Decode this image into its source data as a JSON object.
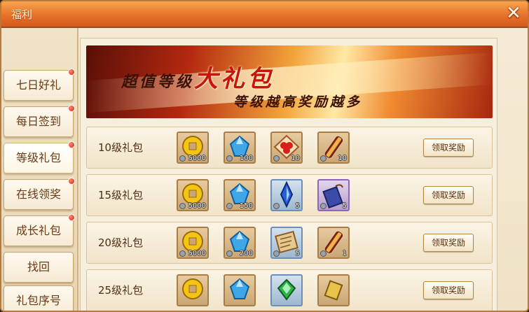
{
  "window": {
    "title": "福利",
    "close_icon": "close-icon"
  },
  "sidebar": {
    "items": [
      {
        "label": "七日好礼",
        "has_alert": true
      },
      {
        "label": "每日签到",
        "has_alert": true
      },
      {
        "label": "等级礼包",
        "has_alert": true,
        "active": true
      },
      {
        "label": "在线领奖",
        "has_alert": true
      },
      {
        "label": "成长礼包",
        "has_alert": true
      },
      {
        "label": "找回",
        "has_alert": false
      },
      {
        "label": "礼包序号",
        "has_alert": false
      }
    ]
  },
  "banner": {
    "title_prefix": "超值等级",
    "title_highlight": "大礼包",
    "subtitle": "等级越高奖励越多"
  },
  "rows": [
    {
      "label": "10级礼包",
      "button": "领取奖励",
      "items": [
        {
          "icon": "copper-coin-icon",
          "count": "5000",
          "frame": "gold"
        },
        {
          "icon": "blue-gem-icon",
          "count": "100",
          "frame": "gold"
        },
        {
          "icon": "red-fruit-icon",
          "count": "10",
          "frame": "gold"
        },
        {
          "icon": "scroll-icon",
          "count": "10",
          "frame": "gold"
        }
      ]
    },
    {
      "label": "15级礼包",
      "button": "领取奖励",
      "items": [
        {
          "icon": "copper-coin-icon",
          "count": "5000",
          "frame": "gold"
        },
        {
          "icon": "blue-gem-icon",
          "count": "150",
          "frame": "gold"
        },
        {
          "icon": "blue-crystal-icon",
          "count": "5",
          "frame": "blue"
        },
        {
          "icon": "purple-token-icon",
          "count": "5",
          "frame": "purple"
        }
      ]
    },
    {
      "label": "20级礼包",
      "button": "领取奖励",
      "items": [
        {
          "icon": "copper-coin-icon",
          "count": "5000",
          "frame": "gold"
        },
        {
          "icon": "blue-gem-icon",
          "count": "200",
          "frame": "gold"
        },
        {
          "icon": "map-scroll-icon",
          "count": "5",
          "frame": "blue"
        },
        {
          "icon": "scroll-icon",
          "count": "1",
          "frame": "gold"
        }
      ]
    },
    {
      "label": "25级礼包",
      "button": "领取奖励",
      "items": [
        {
          "icon": "copper-coin-icon",
          "count": "",
          "frame": "gold"
        },
        {
          "icon": "blue-gem-icon",
          "count": "",
          "frame": "gold"
        },
        {
          "icon": "green-gem-icon",
          "count": "",
          "frame": "blue"
        },
        {
          "icon": "gold-token-icon",
          "count": "",
          "frame": "gold"
        }
      ]
    }
  ]
}
